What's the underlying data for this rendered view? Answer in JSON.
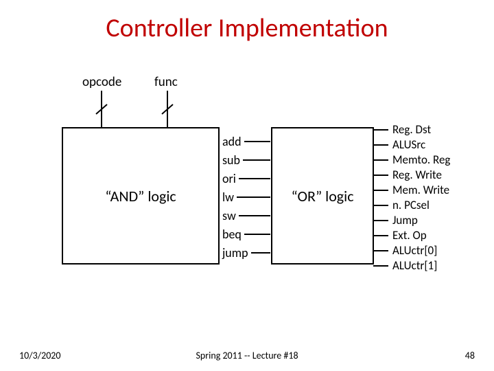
{
  "title": "Controller Implementation",
  "inputs": [
    "opcode",
    "func"
  ],
  "blocks": {
    "and": "“AND” logic",
    "or": "“OR” logic"
  },
  "middle": [
    "add",
    "sub",
    "ori",
    "lw",
    "sw",
    "beq",
    "jump"
  ],
  "outputs": [
    "Reg. Dst",
    "ALUSrc",
    "Memto. Reg",
    "Reg. Write",
    "Mem. Write",
    "n. PCsel",
    "Jump",
    "Ext. Op",
    "ALUctr[0]",
    "ALUctr[1]"
  ],
  "footer": {
    "date": "10/3/2020",
    "center": "Spring 2011 -- Lecture #18",
    "page": "48"
  }
}
